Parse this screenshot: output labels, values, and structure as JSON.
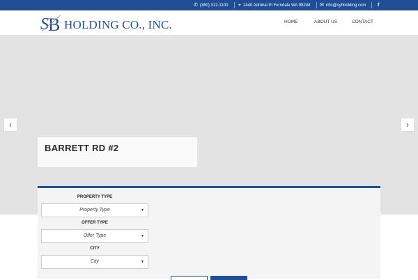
{
  "topbar": {
    "phone": "(360) 312-1100",
    "address": "1440 Admiral Pl Ferndale WA 98248",
    "email": "info@syhbolding.com",
    "facebook": "f"
  },
  "logo": {
    "text": "HOLDING CO., INC."
  },
  "nav": {
    "home": "HOME",
    "about": "ABOUT US",
    "contact": "CONTACT"
  },
  "slider": {
    "prev": "‹",
    "next": "›"
  },
  "listing": {
    "title": "BARRETT RD #2"
  },
  "search": {
    "property_type_label": "PROPERTY TYPE",
    "property_type_value": "Property Type",
    "offer_type_label": "OFFER TYPE",
    "offer_type_value": "Offer Type",
    "city_label": "CITY",
    "city_value": "City",
    "caret": "▼"
  },
  "colors": {
    "brand": "#1f4e96",
    "hero_bg": "#e3e3e3"
  }
}
